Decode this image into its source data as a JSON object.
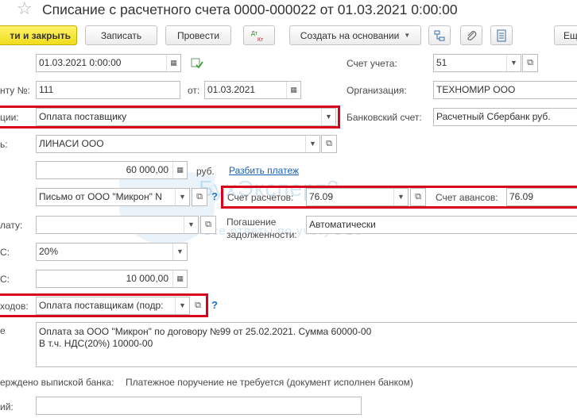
{
  "title": "Списание с расчетного счета 0000-000022 от 01.03.2021 0:00:00",
  "toolbar": {
    "post_close": "ти и закрыть",
    "save": "Записать",
    "post": "Провести",
    "dt_kt": "Дт Кт",
    "create_based": "Создать на основании",
    "more": "Ещ"
  },
  "form": {
    "date": "01.03.2021  0:00:00",
    "doc_no_label": "нту №:",
    "doc_no": "111",
    "from_label": "от:",
    "from_date": "01.03.2021",
    "operation_label": "ции:",
    "operation": "Оплата поставщику",
    "recipient_label": "ь:",
    "recipient": "ЛИНАСИ ООО",
    "amount": "60 000,00",
    "currency": "руб.",
    "split_link": "Разбить платеж",
    "contract": "Письмо от ООО \"Микрон\" N",
    "settle_acc_label": "Счет расчетов:",
    "settle_acc": "76.09",
    "advance_acc_label": "Счет авансов:",
    "advance_acc": "76.09",
    "payment_label": "лату:",
    "payment": "",
    "repay_label_1": "Погашение",
    "repay_label_2": "задолженности:",
    "repay": "Автоматически",
    "vat_label": "С:",
    "vat_rate": "20%",
    "vat_sum_label": "С:",
    "vat_sum": "10 000,00",
    "expense_label": "ходов:",
    "expense": "Оплата поставщикам (подр:",
    "purpose_label": "е",
    "purpose": "Оплата за ООО \"Микрон\" по договору №99 от 25.02.2021. Сумма 60000-00\nВ т.ч. НДС(20%) 10000-00",
    "confirmed_label": "ерждено выпиской банка:",
    "confirmed_value": "Платежное поручение не требуется (документ исполнен банком)",
    "comment_label": "ий:",
    "comment": ""
  },
  "right": {
    "account_label": "Счет учета:",
    "account": "51",
    "org_label": "Организация:",
    "org": "ТЕХНОМИР ООО",
    "bank_label": "Банковский счет:",
    "bank": "Расчетный Сбербанк руб."
  },
  "watermark": {
    "brand": "БухЭксперт8",
    "sub": "Все ответы по учёту в 1С"
  },
  "colors": {
    "highlight": "#d9001b",
    "primary_button": "#f1dc1c",
    "link": "#1a5fb4"
  }
}
